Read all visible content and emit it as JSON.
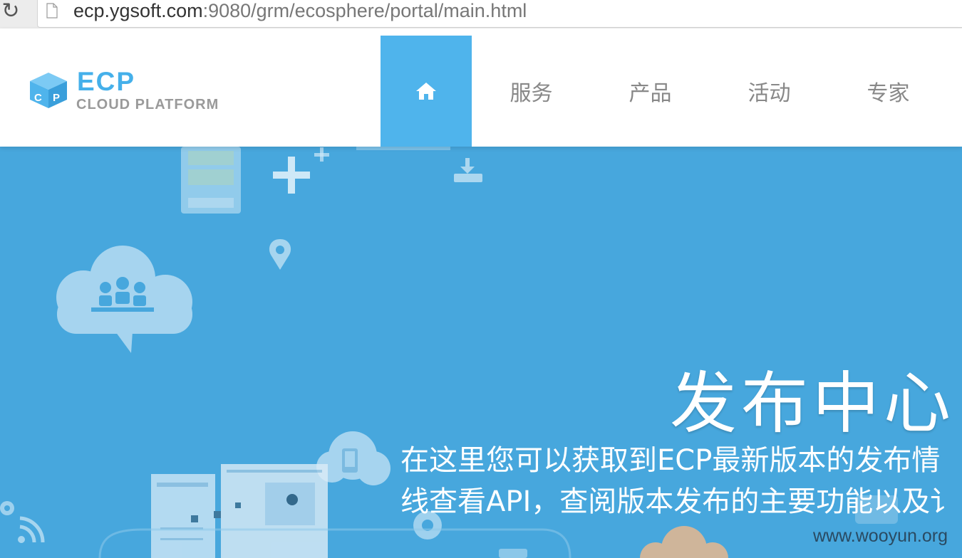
{
  "browser": {
    "reload_icon": "reload-icon",
    "url_host": "ecp.ygsoft.com",
    "url_path": ":9080/grm/ecosphere/portal/main.html"
  },
  "header": {
    "logo_title": "ECP",
    "logo_subtitle": "CLOUD PLATFORM",
    "logo_cube_letters": "CP",
    "nav": {
      "home_icon": "home-icon",
      "items": [
        "服务",
        "产品",
        "活动",
        "专家"
      ]
    },
    "colors": {
      "accent": "#4fb4ec",
      "nav_text": "#888888"
    }
  },
  "hero": {
    "title": "发布中心",
    "desc_line1": "在这里您可以获取到ECP最新版本的发布情",
    "desc_line2": "线查看API，查阅版本发布的主要功能以及讠",
    "background": "#47a7dd"
  },
  "watermark": "www.wooyun.org"
}
